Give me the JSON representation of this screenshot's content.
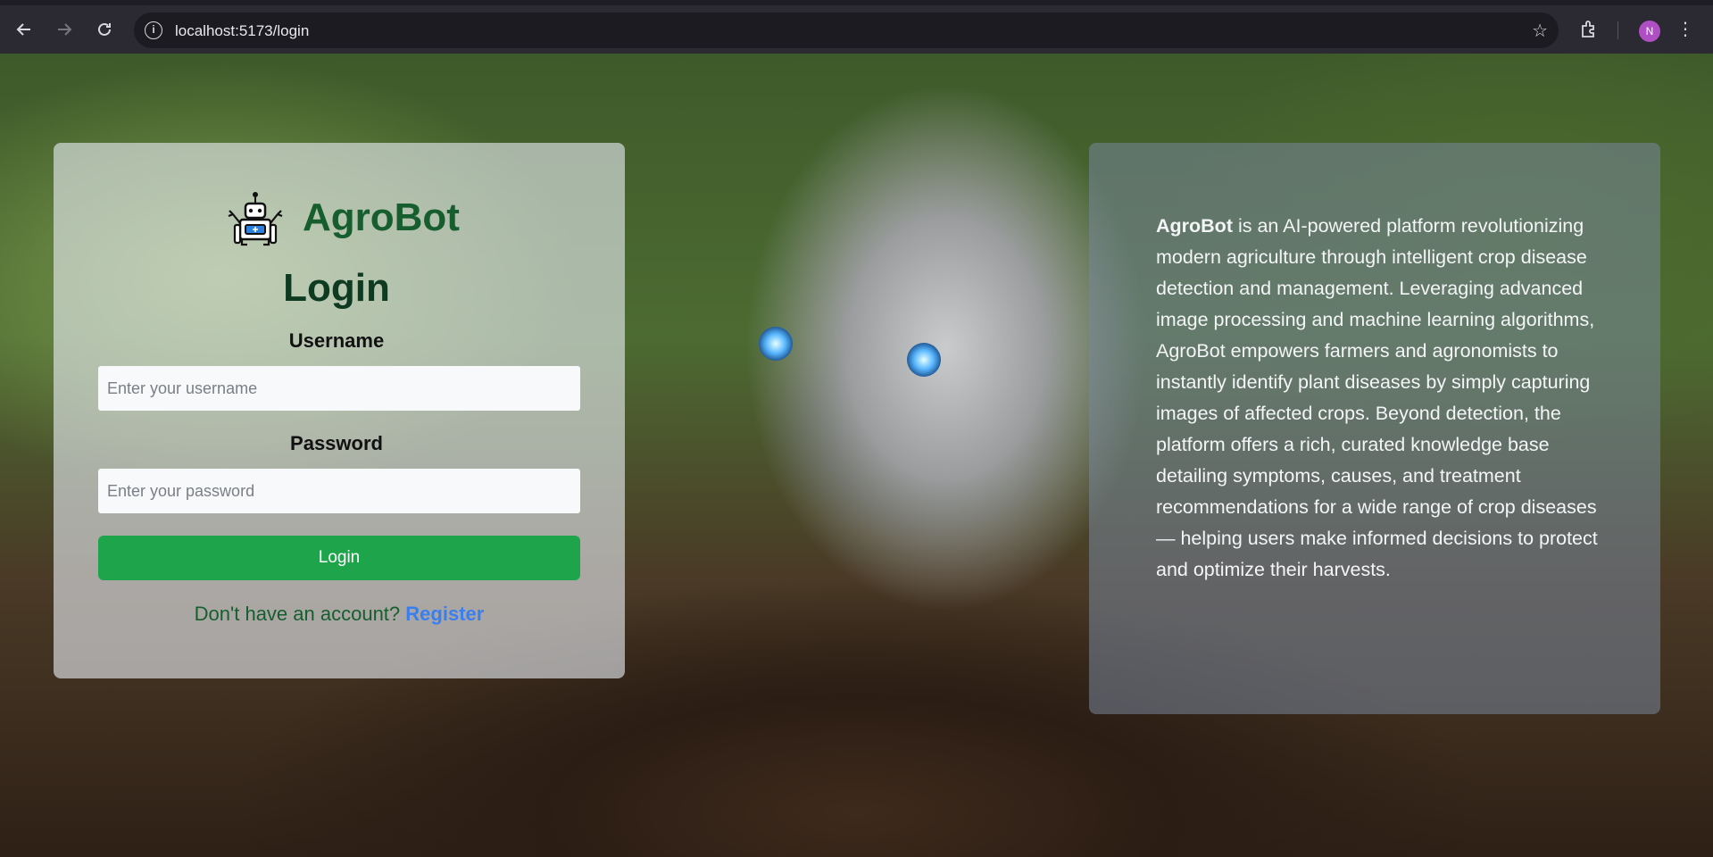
{
  "browser": {
    "url": "localhost:5173/login",
    "profile_initial": "N",
    "icons": [
      "back-arrow-icon",
      "forward-arrow-icon",
      "reload-icon",
      "info-icon",
      "star-icon",
      "extensions-icon",
      "kebab-menu-icon"
    ]
  },
  "login": {
    "brand_name": "AgroBot",
    "title": "Login",
    "username_label": "Username",
    "username_placeholder": "Enter your username",
    "password_label": "Password",
    "password_placeholder": "Enter your password",
    "submit_label": "Login",
    "register_prompt": "Don't have an account?",
    "register_link": "Register"
  },
  "about": {
    "brand": "AgroBot",
    "description": " is an AI-powered platform revolutionizing modern agriculture through intelligent crop disease detection and management. Leveraging advanced image processing and machine learning algorithms, AgroBot empowers farmers and agronomists to instantly identify plant diseases by simply capturing images of affected crops. Beyond detection, the platform offers a rich, curated knowledge base detailing symptoms, causes, and treatment recommendations for a wide range of crop diseases — helping users make informed decisions to protect and optimize their harvests."
  },
  "colors": {
    "brand_green": "#175e2f",
    "button_green": "#1ea54c",
    "link_blue": "#3a7ff0"
  }
}
